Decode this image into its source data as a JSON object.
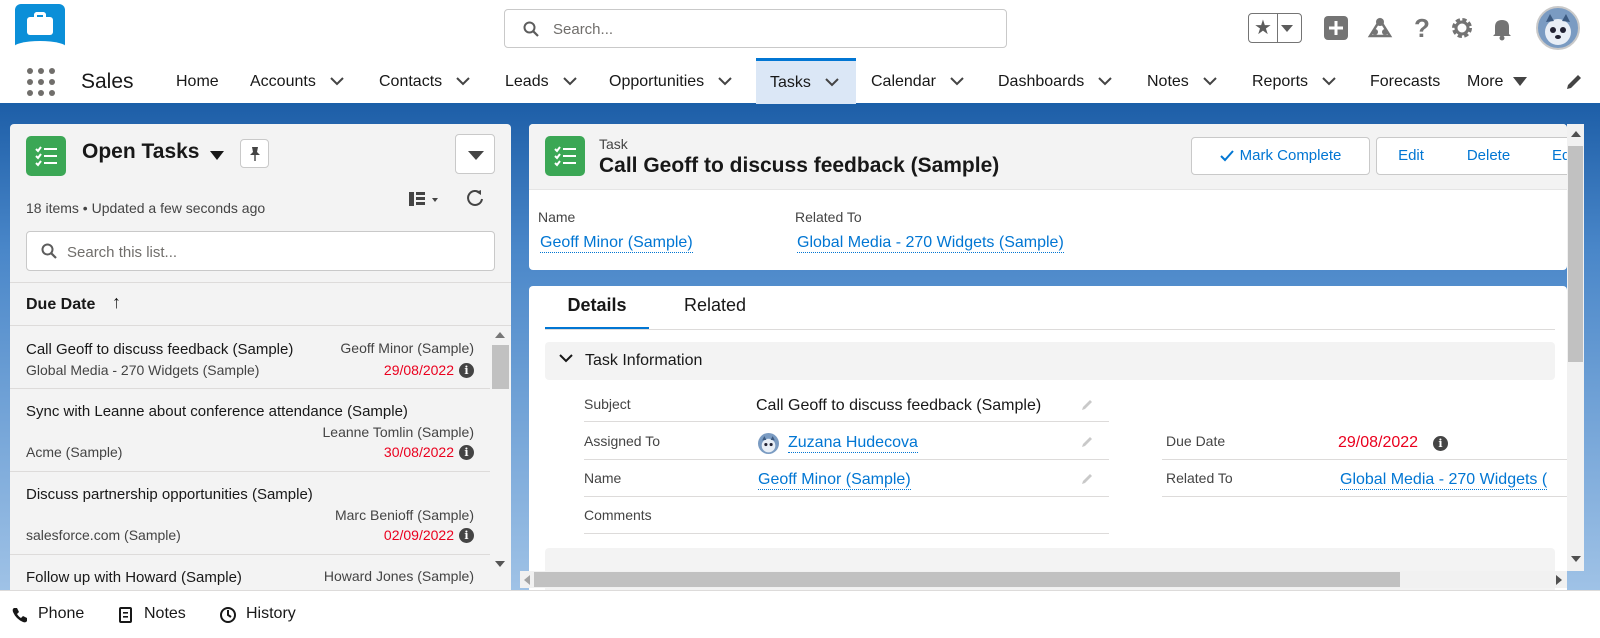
{
  "header": {
    "search_placeholder": "Search..."
  },
  "nav": {
    "app_name": "Sales",
    "items": [
      {
        "label": "Home"
      },
      {
        "label": "Accounts"
      },
      {
        "label": "Contacts"
      },
      {
        "label": "Leads"
      },
      {
        "label": "Opportunities"
      },
      {
        "label": "Tasks"
      },
      {
        "label": "Calendar"
      },
      {
        "label": "Dashboards"
      },
      {
        "label": "Notes"
      },
      {
        "label": "Reports"
      },
      {
        "label": "Forecasts"
      },
      {
        "label": "More"
      }
    ],
    "active": "Tasks"
  },
  "list": {
    "title": "Open Tasks",
    "meta": "18 items • Updated a few seconds ago",
    "search_placeholder": "Search this list...",
    "sort_label": "Due Date",
    "sort_arrow": "↑",
    "rows": [
      {
        "subject": "Call Geoff to discuss feedback (Sample)",
        "who": "Geoff Minor (Sample)",
        "what": "Global Media - 270 Widgets (Sample)",
        "date": "29/08/2022"
      },
      {
        "subject": "Sync with Leanne about conference attendance (Sample)",
        "who": "Leanne Tomlin (Sample)",
        "what": "Acme (Sample)",
        "date": "30/08/2022"
      },
      {
        "subject": "Discuss partnership opportunities (Sample)",
        "who": "Marc Benioff (Sample)",
        "what": "salesforce.com (Sample)",
        "date": "02/09/2022"
      },
      {
        "subject": "Follow up with Howard (Sample)",
        "who": "Howard Jones (Sample)",
        "what": "",
        "date": ""
      }
    ]
  },
  "record": {
    "type": "Task",
    "title": "Call Geoff to discuss feedback (Sample)",
    "buttons": {
      "mark_complete": "Mark Complete",
      "edit": "Edit",
      "delete": "Delete",
      "overflow": "Ed"
    },
    "highlights": {
      "name_label": "Name",
      "name_value": "Geoff Minor (Sample)",
      "related_label": "Related To",
      "related_value": "Global Media - 270 Widgets (Sample)"
    },
    "tabs": {
      "details": "Details",
      "related": "Related"
    },
    "section": "Task Information",
    "fields": {
      "subject_label": "Subject",
      "subject_value": "Call Geoff to discuss feedback (Sample)",
      "assigned_label": "Assigned To",
      "assigned_value": "Zuzana Hudecova",
      "name_label": "Name",
      "name_value": "Geoff Minor (Sample)",
      "comments_label": "Comments",
      "due_label": "Due Date",
      "due_value": "29/08/2022",
      "related_label": "Related To",
      "related_value": "Global Media - 270 Widgets ("
    }
  },
  "utility": {
    "phone": "Phone",
    "notes": "Notes",
    "history": "History"
  },
  "colors": {
    "brand_blue": "#0176d3",
    "task_green": "#3ba755",
    "overdue_red": "#ea001e"
  }
}
